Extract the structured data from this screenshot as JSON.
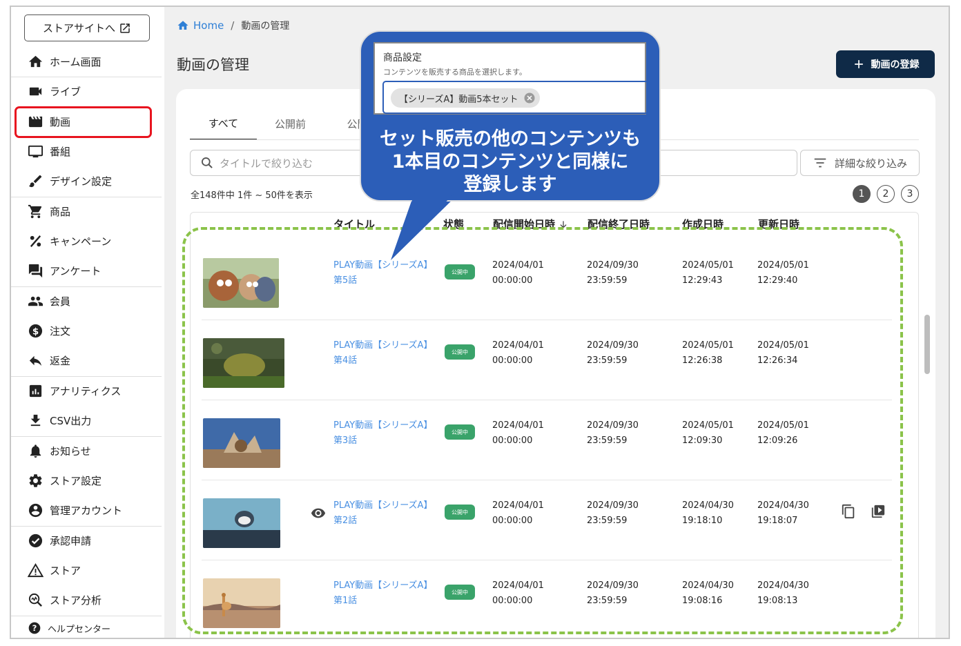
{
  "sidebar": {
    "store_button": "ストアサイトへ",
    "items": [
      {
        "label": "ホーム画面",
        "icon": "home-icon"
      },
      {
        "label": "ライブ",
        "icon": "videocam-icon"
      },
      {
        "label": "動画",
        "icon": "movie-icon"
      },
      {
        "label": "番組",
        "icon": "monitor-icon"
      },
      {
        "label": "デザイン設定",
        "icon": "brush-icon"
      },
      {
        "label": "商品",
        "icon": "cart-icon"
      },
      {
        "label": "キャンペーン",
        "icon": "percent-icon"
      },
      {
        "label": "アンケート",
        "icon": "forum-icon"
      },
      {
        "label": "会員",
        "icon": "people-icon"
      },
      {
        "label": "注文",
        "icon": "dollar-icon"
      },
      {
        "label": "返金",
        "icon": "reply-icon"
      },
      {
        "label": "アナリティクス",
        "icon": "analytics-icon"
      },
      {
        "label": "CSV出力",
        "icon": "download-icon"
      },
      {
        "label": "お知らせ",
        "icon": "bell-icon"
      },
      {
        "label": "ストア設定",
        "icon": "gear-icon"
      },
      {
        "label": "管理アカウント",
        "icon": "account-icon"
      },
      {
        "label": "承認申請",
        "icon": "check-circle-icon"
      },
      {
        "label": "ストア",
        "icon": "warning-icon"
      },
      {
        "label": "ストア分析",
        "icon": "search-analytics-icon"
      },
      {
        "label": "ヘルプセンター",
        "icon": "help-icon"
      }
    ]
  },
  "breadcrumb": {
    "home": "Home",
    "current": "動画の管理"
  },
  "page_title": "動画の管理",
  "add_button": "動画の登録",
  "tabs": [
    "すべて",
    "公開前",
    "公開"
  ],
  "search_placeholder": "タイトルで絞り込む",
  "filter_button": "詳細な絞り込み",
  "count_text": "全148件中 1件 ~ 50件を表示",
  "pages": [
    "1",
    "2",
    "3"
  ],
  "columns": {
    "title": "タイトル",
    "status": "状態",
    "start": "配信開始日時",
    "end": "配信終了日時",
    "created": "作成日時",
    "updated": "更新日時"
  },
  "rows": [
    {
      "title1": "PLAY動画【シリーズA】",
      "title2": "第5話",
      "status": "公開中",
      "start": "2024/04/01\n00:00:00",
      "end": "2024/09/30\n23:59:59",
      "created": "2024/05/01\n12:29:43",
      "updated": "2024/05/01\n12:29:40"
    },
    {
      "title1": "PLAY動画【シリーズA】",
      "title2": "第4話",
      "status": "公開中",
      "start": "2024/04/01\n00:00:00",
      "end": "2024/09/30\n23:59:59",
      "created": "2024/05/01\n12:26:38",
      "updated": "2024/05/01\n12:26:34"
    },
    {
      "title1": "PLAY動画【シリーズA】",
      "title2": "第3話",
      "status": "公開中",
      "start": "2024/04/01\n00:00:00",
      "end": "2024/09/30\n23:59:59",
      "created": "2024/05/01\n12:09:30",
      "updated": "2024/05/01\n12:09:26"
    },
    {
      "title1": "PLAY動画【シリーズA】",
      "title2": "第2話",
      "status": "公開中",
      "start": "2024/04/01\n00:00:00",
      "end": "2024/09/30\n23:59:59",
      "created": "2024/04/30\n19:18:10",
      "updated": "2024/04/30\n19:18:07"
    },
    {
      "title1": "PLAY動画【シリーズA】",
      "title2": "第1話",
      "status": "公開中",
      "start": "2024/04/01\n00:00:00",
      "end": "2024/09/30\n23:59:59",
      "created": "2024/04/30\n19:08:16",
      "updated": "2024/04/30\n19:08:13"
    }
  ],
  "popup": {
    "title": "商品設定",
    "subtitle": "コンテンツを販売する商品を選択します。",
    "chip": "【シリーズA】動画5本セット"
  },
  "callout": {
    "line1": "セット販売の他のコンテンツも",
    "line2": "1本目のコンテンツと同様に",
    "line3": "登録します"
  },
  "colors": {
    "accent": "#0f2a47",
    "link": "#4a90e2",
    "status_badge": "#3aa36a",
    "callout": "#2c5eb8",
    "highlight": "#e8141f",
    "dash": "#8bc34a"
  }
}
